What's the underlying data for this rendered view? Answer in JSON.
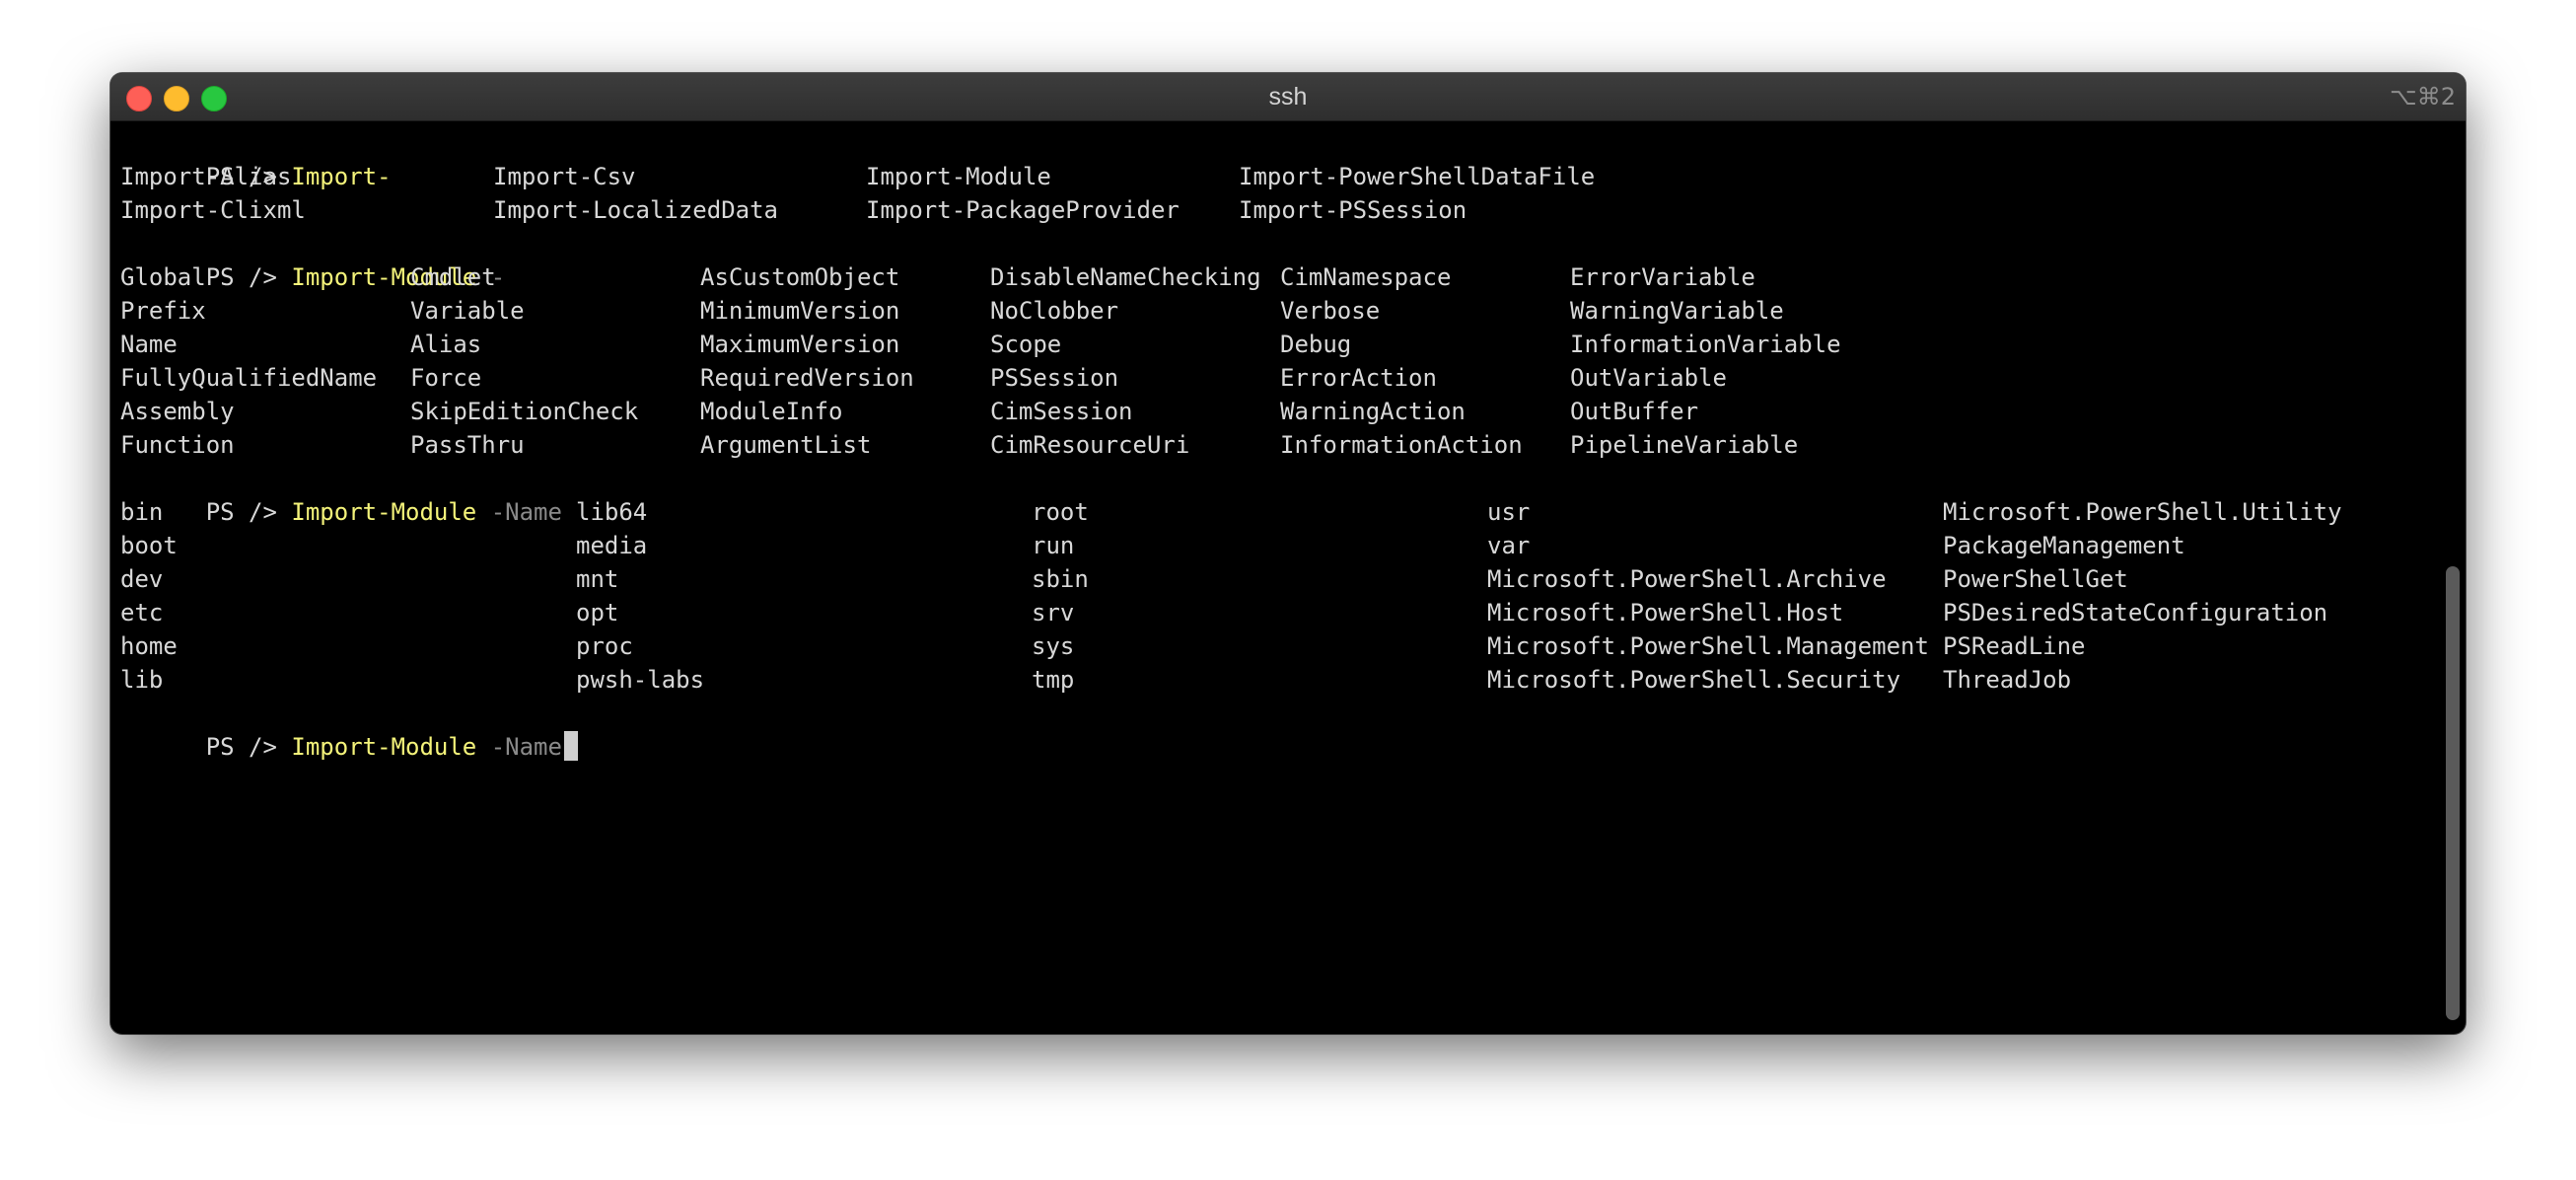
{
  "window": {
    "title": "ssh",
    "shortcut": "⌥⌘2"
  },
  "terminal": {
    "prompt": "PS />",
    "line1_cmd": "Import-",
    "line1_completions": [
      [
        "Import-Alias",
        "Import-Csv",
        "Import-Module",
        "Import-PowerShellDataFile"
      ],
      [
        "Import-Clixml",
        "Import-LocalizedData",
        "Import-PackageProvider",
        "Import-PSSession"
      ]
    ],
    "line2_cmd": "Import-Module",
    "line2_param": "-",
    "line2_completions": [
      [
        "Global",
        "Cmdlet",
        "AsCustomObject",
        "DisableNameChecking",
        "CimNamespace",
        "ErrorVariable"
      ],
      [
        "Prefix",
        "Variable",
        "MinimumVersion",
        "NoClobber",
        "Verbose",
        "WarningVariable"
      ],
      [
        "Name",
        "Alias",
        "MaximumVersion",
        "Scope",
        "Debug",
        "InformationVariable"
      ],
      [
        "FullyQualifiedName",
        "Force",
        "RequiredVersion",
        "PSSession",
        "ErrorAction",
        "OutVariable"
      ],
      [
        "Assembly",
        "SkipEditionCheck",
        "ModuleInfo",
        "CimSession",
        "WarningAction",
        "OutBuffer"
      ],
      [
        "Function",
        "PassThru",
        "ArgumentList",
        "CimResourceUri",
        "InformationAction",
        "PipelineVariable"
      ]
    ],
    "line3_cmd": "Import-Module",
    "line3_param": "-Name",
    "line3_completions": [
      [
        "bin",
        "lib64",
        "root",
        "usr",
        "Microsoft.PowerShell.Utility"
      ],
      [
        "boot",
        "media",
        "run",
        "var",
        "PackageManagement"
      ],
      [
        "dev",
        "mnt",
        "sbin",
        "Microsoft.PowerShell.Archive",
        "PowerShellGet"
      ],
      [
        "etc",
        "opt",
        "srv",
        "Microsoft.PowerShell.Host",
        "PSDesiredStateConfiguration"
      ],
      [
        "home",
        "proc",
        "sys",
        "Microsoft.PowerShell.Management",
        "PSReadLine"
      ],
      [
        "lib",
        "pwsh-labs",
        "tmp",
        "Microsoft.PowerShell.Security",
        "ThreadJob"
      ]
    ],
    "line4_cmd": "Import-Module",
    "line4_param": "-Name"
  }
}
